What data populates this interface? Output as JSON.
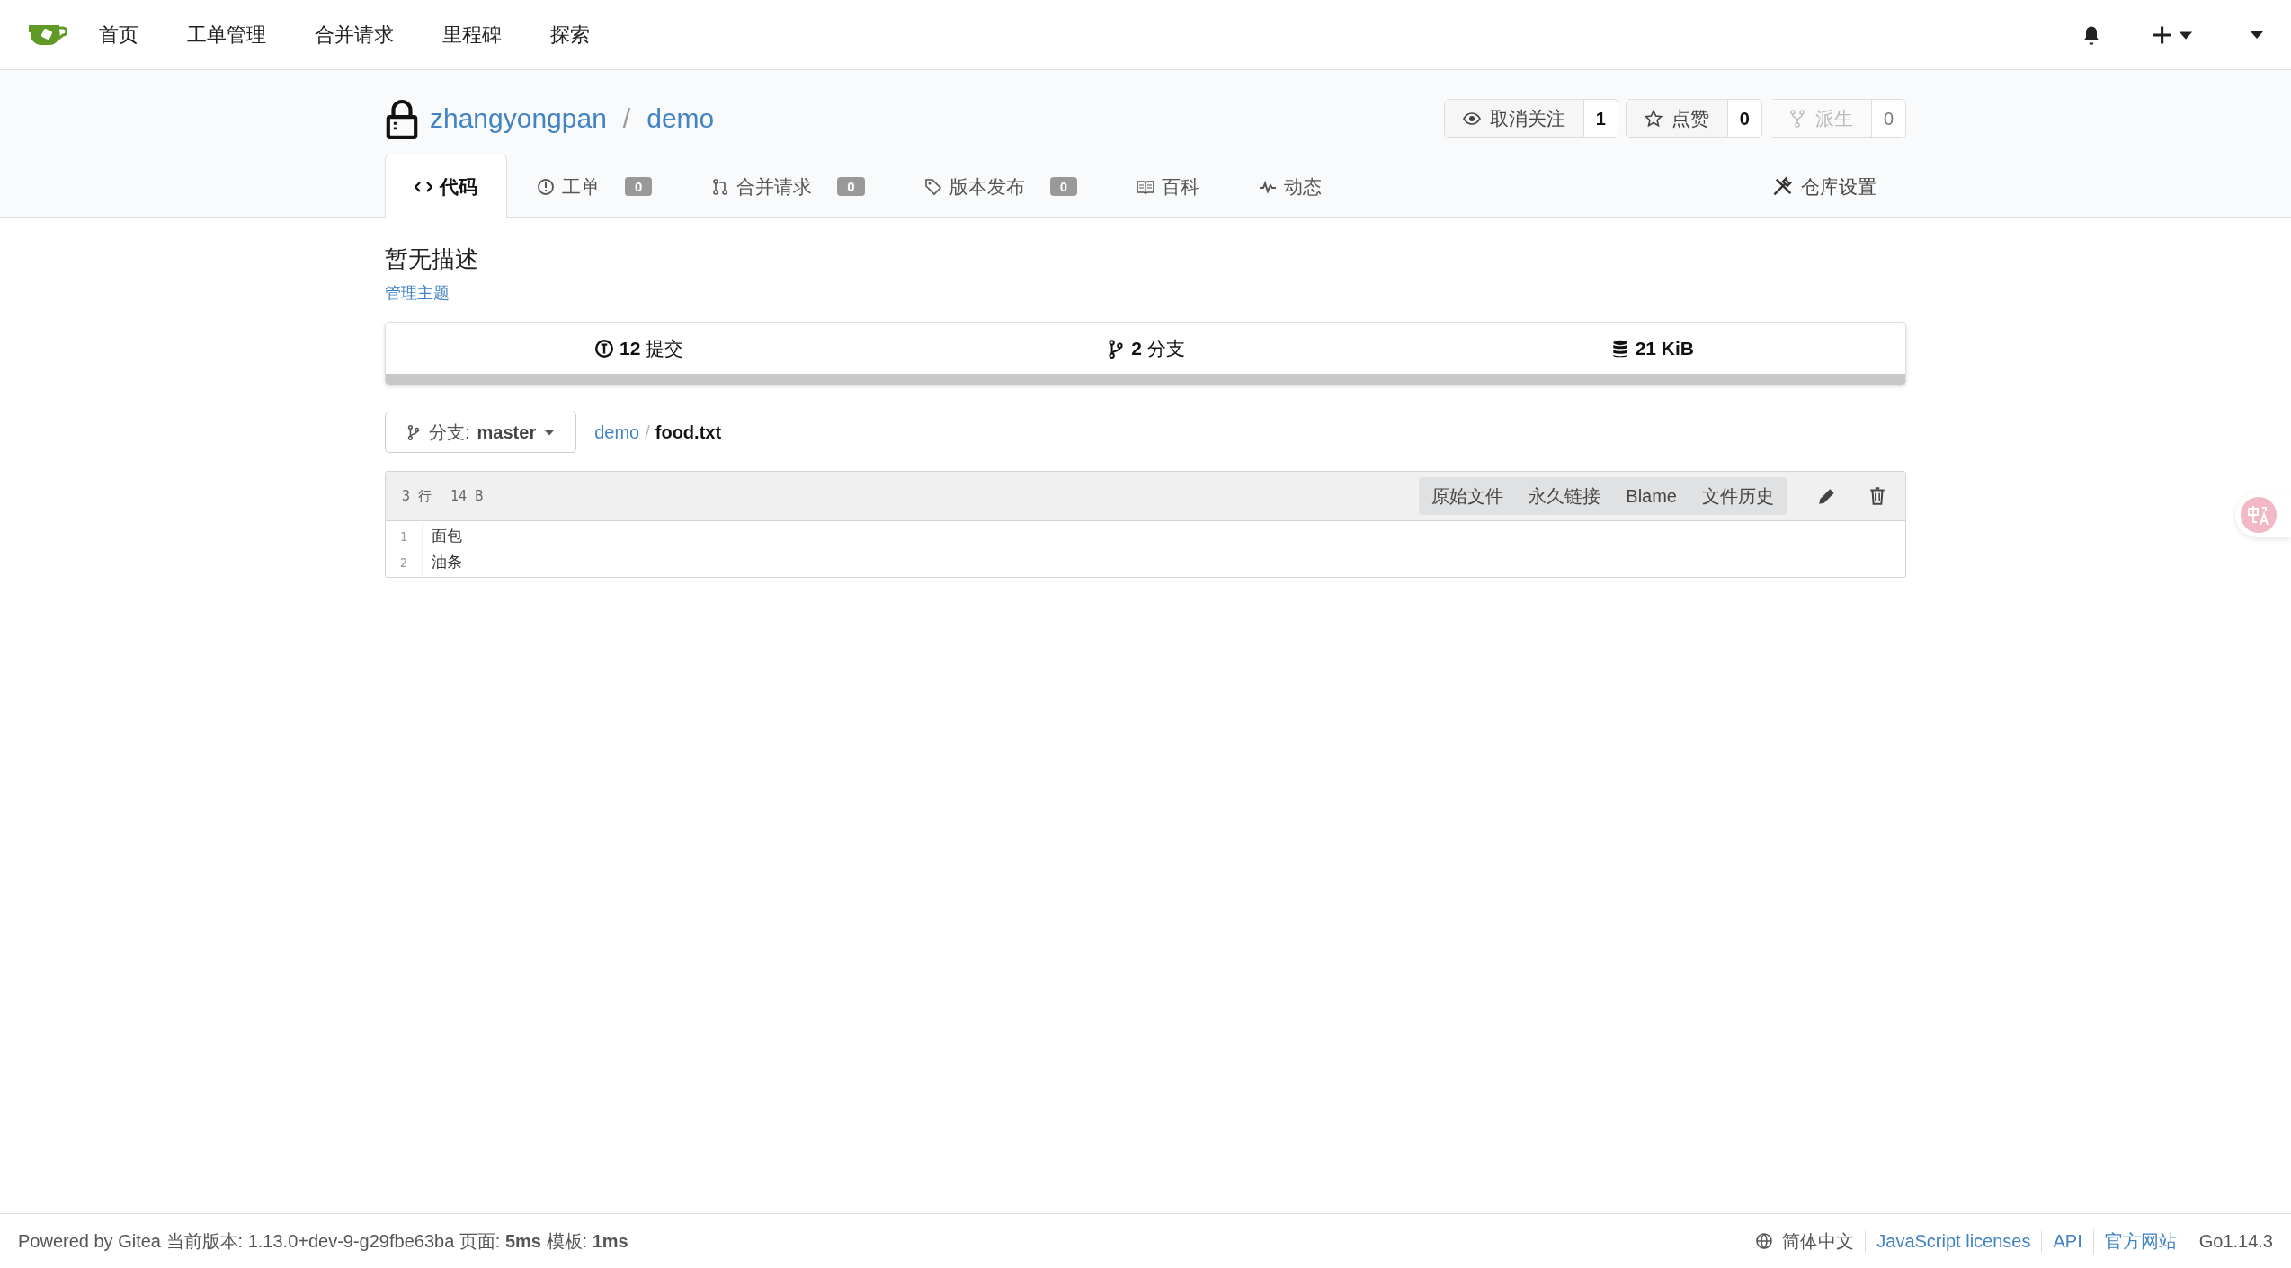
{
  "nav": {
    "items": [
      {
        "label": "首页"
      },
      {
        "label": "工单管理"
      },
      {
        "label": "合并请求"
      },
      {
        "label": "里程碑"
      },
      {
        "label": "探索"
      }
    ]
  },
  "repo": {
    "owner": "zhangyongpan",
    "separator": "/",
    "name": "demo",
    "private": true
  },
  "actions": [
    {
      "kind": "watch",
      "label": "取消关注",
      "count": "1",
      "disabled": false
    },
    {
      "kind": "star",
      "label": "点赞",
      "count": "0",
      "disabled": false
    },
    {
      "kind": "fork",
      "label": "派生",
      "count": "0",
      "disabled": true
    }
  ],
  "tabs": [
    {
      "kind": "code",
      "label": "代码",
      "selected": true
    },
    {
      "kind": "issue",
      "label": "工单",
      "count": "0",
      "selected": false
    },
    {
      "kind": "pr",
      "label": "合并请求",
      "count": "0",
      "selected": false
    },
    {
      "kind": "tag",
      "label": "版本发布",
      "count": "0",
      "selected": false
    },
    {
      "kind": "wiki",
      "label": "百科",
      "selected": false
    },
    {
      "kind": "activity",
      "label": "动态",
      "selected": false
    }
  ],
  "settings_tab": {
    "label": "仓库设置"
  },
  "description": "暂无描述",
  "topics_link": "管理主题",
  "stats": [
    {
      "kind": "commit",
      "number": "12",
      "label": "提交"
    },
    {
      "kind": "branch",
      "number": "2",
      "label": "分支"
    },
    {
      "kind": "size",
      "number": "21 KiB"
    }
  ],
  "branch": {
    "prefix": "分支:",
    "name": "master"
  },
  "breadcrumb": {
    "repo": "demo",
    "separator": "/",
    "file": "food.txt"
  },
  "file": {
    "line_count": "3 行",
    "size": "14 B",
    "buttons": [
      "原始文件",
      "永久链接",
      "Blame",
      "文件历史"
    ],
    "lines": [
      {
        "number": "1",
        "text": "面包"
      },
      {
        "number": "2",
        "text": "油条"
      }
    ]
  },
  "footer": {
    "text": "Powered by Gitea 当前版本: 1.13.0+dev-9-g29fbe63ba 页面: **5ms** 模板: **1ms**",
    "language": "简体中文",
    "links": [
      "JavaScript licenses",
      "API",
      "官方网站"
    ],
    "version": "Go1.14.3"
  }
}
